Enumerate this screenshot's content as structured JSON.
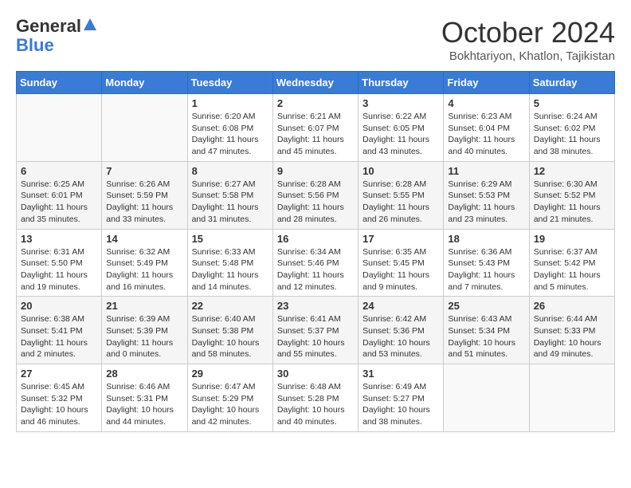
{
  "header": {
    "logo_general": "General",
    "logo_blue": "Blue",
    "month": "October 2024",
    "location": "Bokhtariyon, Khatlon, Tajikistan"
  },
  "days_of_week": [
    "Sunday",
    "Monday",
    "Tuesday",
    "Wednesday",
    "Thursday",
    "Friday",
    "Saturday"
  ],
  "weeks": [
    [
      {
        "day": "",
        "info": ""
      },
      {
        "day": "",
        "info": ""
      },
      {
        "day": "1",
        "info": "Sunrise: 6:20 AM\nSunset: 6:08 PM\nDaylight: 11 hours and 47 minutes."
      },
      {
        "day": "2",
        "info": "Sunrise: 6:21 AM\nSunset: 6:07 PM\nDaylight: 11 hours and 45 minutes."
      },
      {
        "day": "3",
        "info": "Sunrise: 6:22 AM\nSunset: 6:05 PM\nDaylight: 11 hours and 43 minutes."
      },
      {
        "day": "4",
        "info": "Sunrise: 6:23 AM\nSunset: 6:04 PM\nDaylight: 11 hours and 40 minutes."
      },
      {
        "day": "5",
        "info": "Sunrise: 6:24 AM\nSunset: 6:02 PM\nDaylight: 11 hours and 38 minutes."
      }
    ],
    [
      {
        "day": "6",
        "info": "Sunrise: 6:25 AM\nSunset: 6:01 PM\nDaylight: 11 hours and 35 minutes."
      },
      {
        "day": "7",
        "info": "Sunrise: 6:26 AM\nSunset: 5:59 PM\nDaylight: 11 hours and 33 minutes."
      },
      {
        "day": "8",
        "info": "Sunrise: 6:27 AM\nSunset: 5:58 PM\nDaylight: 11 hours and 31 minutes."
      },
      {
        "day": "9",
        "info": "Sunrise: 6:28 AM\nSunset: 5:56 PM\nDaylight: 11 hours and 28 minutes."
      },
      {
        "day": "10",
        "info": "Sunrise: 6:28 AM\nSunset: 5:55 PM\nDaylight: 11 hours and 26 minutes."
      },
      {
        "day": "11",
        "info": "Sunrise: 6:29 AM\nSunset: 5:53 PM\nDaylight: 11 hours and 23 minutes."
      },
      {
        "day": "12",
        "info": "Sunrise: 6:30 AM\nSunset: 5:52 PM\nDaylight: 11 hours and 21 minutes."
      }
    ],
    [
      {
        "day": "13",
        "info": "Sunrise: 6:31 AM\nSunset: 5:50 PM\nDaylight: 11 hours and 19 minutes."
      },
      {
        "day": "14",
        "info": "Sunrise: 6:32 AM\nSunset: 5:49 PM\nDaylight: 11 hours and 16 minutes."
      },
      {
        "day": "15",
        "info": "Sunrise: 6:33 AM\nSunset: 5:48 PM\nDaylight: 11 hours and 14 minutes."
      },
      {
        "day": "16",
        "info": "Sunrise: 6:34 AM\nSunset: 5:46 PM\nDaylight: 11 hours and 12 minutes."
      },
      {
        "day": "17",
        "info": "Sunrise: 6:35 AM\nSunset: 5:45 PM\nDaylight: 11 hours and 9 minutes."
      },
      {
        "day": "18",
        "info": "Sunrise: 6:36 AM\nSunset: 5:43 PM\nDaylight: 11 hours and 7 minutes."
      },
      {
        "day": "19",
        "info": "Sunrise: 6:37 AM\nSunset: 5:42 PM\nDaylight: 11 hours and 5 minutes."
      }
    ],
    [
      {
        "day": "20",
        "info": "Sunrise: 6:38 AM\nSunset: 5:41 PM\nDaylight: 11 hours and 2 minutes."
      },
      {
        "day": "21",
        "info": "Sunrise: 6:39 AM\nSunset: 5:39 PM\nDaylight: 11 hours and 0 minutes."
      },
      {
        "day": "22",
        "info": "Sunrise: 6:40 AM\nSunset: 5:38 PM\nDaylight: 10 hours and 58 minutes."
      },
      {
        "day": "23",
        "info": "Sunrise: 6:41 AM\nSunset: 5:37 PM\nDaylight: 10 hours and 55 minutes."
      },
      {
        "day": "24",
        "info": "Sunrise: 6:42 AM\nSunset: 5:36 PM\nDaylight: 10 hours and 53 minutes."
      },
      {
        "day": "25",
        "info": "Sunrise: 6:43 AM\nSunset: 5:34 PM\nDaylight: 10 hours and 51 minutes."
      },
      {
        "day": "26",
        "info": "Sunrise: 6:44 AM\nSunset: 5:33 PM\nDaylight: 10 hours and 49 minutes."
      }
    ],
    [
      {
        "day": "27",
        "info": "Sunrise: 6:45 AM\nSunset: 5:32 PM\nDaylight: 10 hours and 46 minutes."
      },
      {
        "day": "28",
        "info": "Sunrise: 6:46 AM\nSunset: 5:31 PM\nDaylight: 10 hours and 44 minutes."
      },
      {
        "day": "29",
        "info": "Sunrise: 6:47 AM\nSunset: 5:29 PM\nDaylight: 10 hours and 42 minutes."
      },
      {
        "day": "30",
        "info": "Sunrise: 6:48 AM\nSunset: 5:28 PM\nDaylight: 10 hours and 40 minutes."
      },
      {
        "day": "31",
        "info": "Sunrise: 6:49 AM\nSunset: 5:27 PM\nDaylight: 10 hours and 38 minutes."
      },
      {
        "day": "",
        "info": ""
      },
      {
        "day": "",
        "info": ""
      }
    ]
  ]
}
